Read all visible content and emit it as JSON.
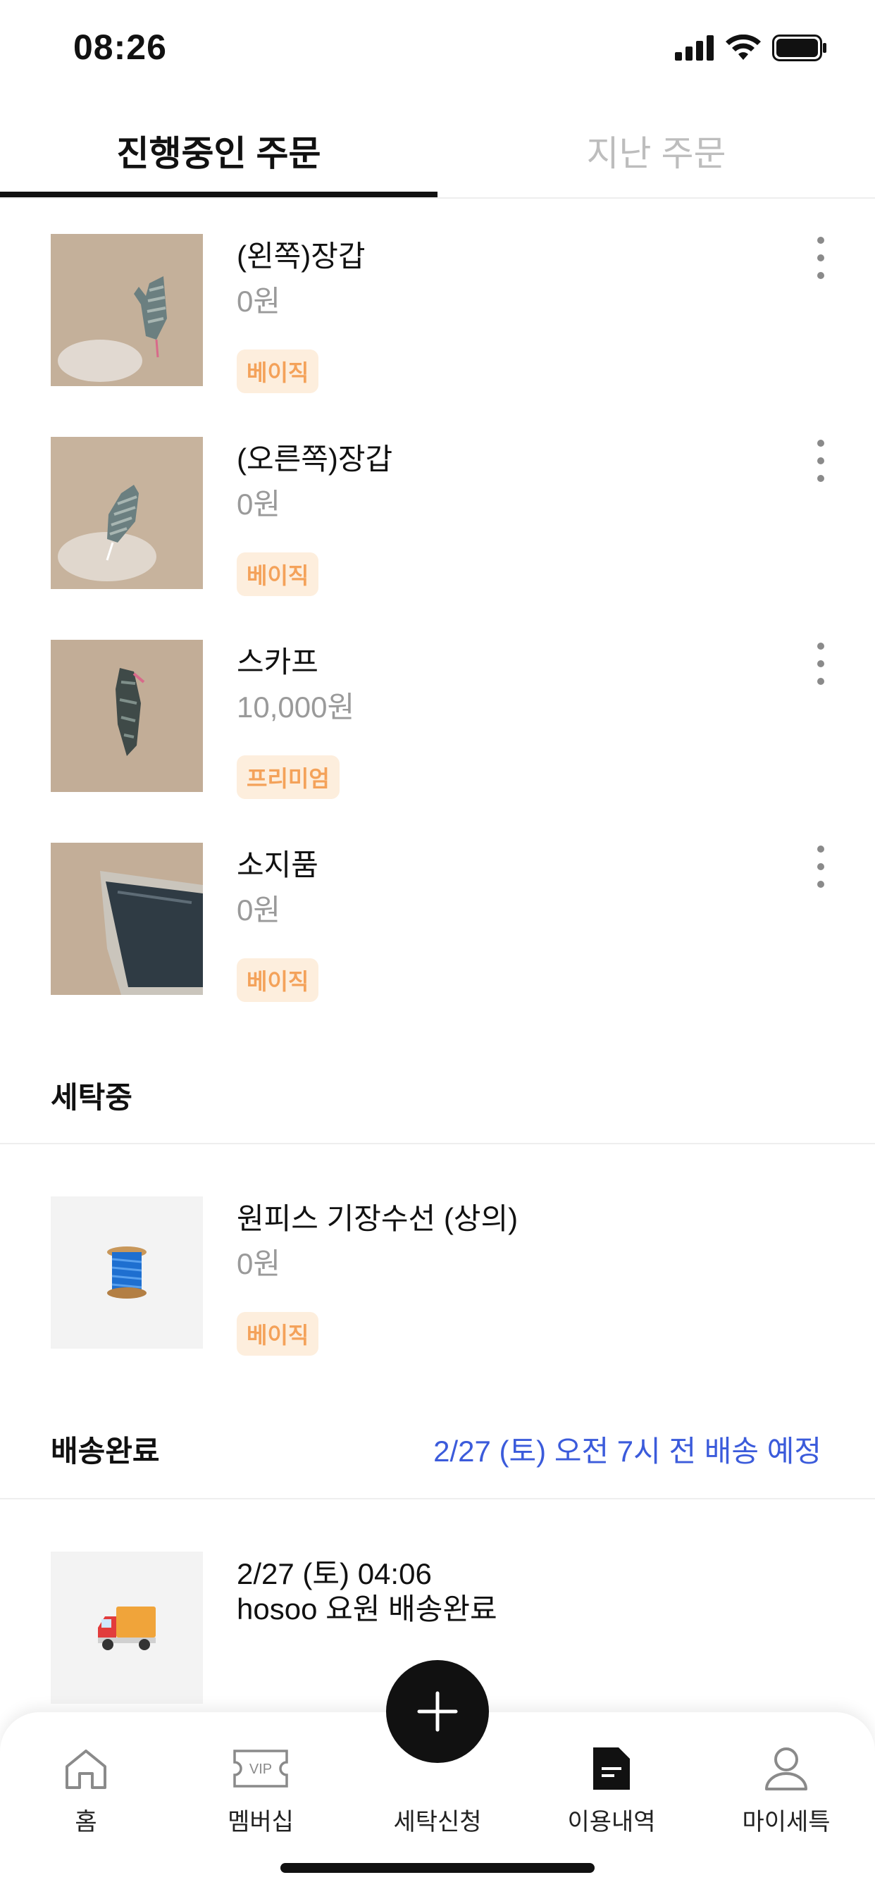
{
  "status_bar": {
    "time": "08:26"
  },
  "tabs": [
    {
      "label": "진행중인 주문",
      "active": true
    },
    {
      "label": "지난 주문",
      "active": false
    }
  ],
  "items": [
    {
      "name": "(왼쪽)장갑",
      "price": "0원",
      "badge": "베이직",
      "thumb": "glove-left-photo"
    },
    {
      "name": "(오른쪽)장갑",
      "price": "0원",
      "badge": "베이직",
      "thumb": "glove-right-photo"
    },
    {
      "name": "스카프",
      "price": "10,000원",
      "badge": "프리미엄",
      "thumb": "scarf-photo"
    },
    {
      "name": "소지품",
      "price": "0원",
      "badge": "베이직",
      "thumb": "pouch-photo"
    }
  ],
  "washing": {
    "title": "세탁중",
    "item": {
      "name": "원피스 기장수선 (상의)",
      "price": "0원",
      "badge": "베이직",
      "icon": "thread-spool-icon"
    }
  },
  "delivered": {
    "title": "배송완료",
    "eta": "2/27 (토) 오전 7시 전 배송 예정",
    "item": {
      "line1": "2/27 (토) 04:06",
      "line2": "hosoo 요원 배송완료",
      "icon": "delivery-truck-icon"
    }
  },
  "bottom_nav": [
    {
      "label": "홈",
      "icon": "home-icon"
    },
    {
      "label": "멤버십",
      "icon": "vip-ticket-icon"
    },
    {
      "label": "세탁신청",
      "icon": "plus-icon"
    },
    {
      "label": "이용내역",
      "icon": "document-icon"
    },
    {
      "label": "마이세특",
      "icon": "person-icon"
    }
  ],
  "colors": {
    "accent_blue": "#3b5bdb",
    "badge_bg": "#fdeedd",
    "badge_text": "#f4a25a"
  }
}
